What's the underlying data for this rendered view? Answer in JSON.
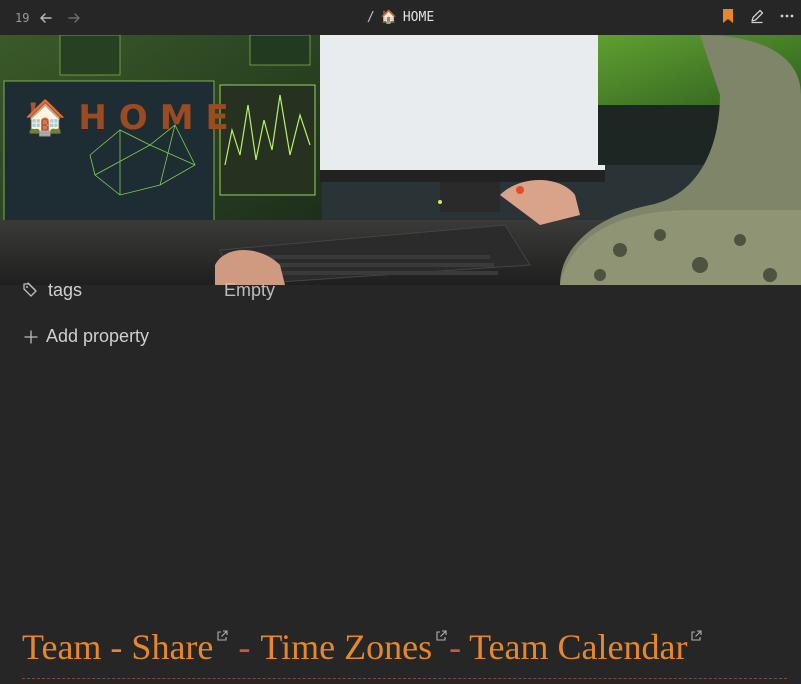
{
  "topbar": {
    "history_count": "19",
    "breadcrumb_sep": "/",
    "breadcrumb_emoji": "🏠",
    "breadcrumb_title": "HOME"
  },
  "page": {
    "title_emoji": "🏠",
    "title": "HOME"
  },
  "properties": [
    {
      "name": "tags",
      "value": "Empty"
    }
  ],
  "add_property_label": "Add property",
  "links": {
    "team_share": "Team - Share",
    "sep1": "-",
    "time_zones": "Time Zones",
    "sep2": "-",
    "team_calendar": "Team Calendar"
  },
  "colors": {
    "accent": "#e6872c",
    "bookmark": "#e6872c",
    "title_brown": "#9a4b22",
    "background": "#262626"
  },
  "icons": [
    "arrow-left-icon",
    "arrow-right-icon",
    "bookmark-icon",
    "pencil-icon",
    "more-icon",
    "tag-icon",
    "plus-icon",
    "external-link-icon"
  ]
}
